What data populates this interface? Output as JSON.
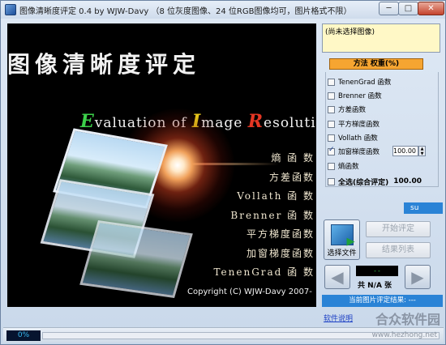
{
  "window": {
    "title": "图像清晰度评定 0.4 by WJW-Davy （8 位灰度图像、24 位RGB图像均可，图片格式不限）",
    "min_symbol": "─",
    "max_symbol": "□",
    "close_symbol": "✕"
  },
  "banner": {
    "title_cn": "图像清晰度评定",
    "en_cap_e": "E",
    "en_rest_e": "valuation of ",
    "en_cap_i": "I",
    "en_rest_i": "mage ",
    "en_cap_r": "R",
    "en_rest_r": "esolutio",
    "methods": [
      "熵 函 数",
      "方差函数",
      "Vollath 函 数",
      "Brenner 函 数",
      "平方梯度函数",
      "加窗梯度函数",
      "TenenGrad 函 数"
    ],
    "copyright": "Copyright (C) WJW-Davy 2007-"
  },
  "file_box": {
    "text": "(尚未选择图像)"
  },
  "method_panel": {
    "header": "方法  权重(%)",
    "methods": [
      {
        "label": "TenenGrad 函数",
        "checked": false
      },
      {
        "label": "Brenner 函数",
        "checked": false
      },
      {
        "label": "方差函数",
        "checked": false
      },
      {
        "label": "平方梯度函数",
        "checked": false
      },
      {
        "label": "Vollath 函数",
        "checked": false
      },
      {
        "label": "加窗梯度函数",
        "checked": true
      },
      {
        "label": "熵函数",
        "checked": false
      }
    ],
    "weight_value": "100.00",
    "select_all_label": "全选(综合评定)",
    "select_all_score": "100.00"
  },
  "score_bar": {
    "text": "su"
  },
  "buttons": {
    "select_file": "选择文件",
    "start_eval": "开始评定",
    "result_list": "结果列表",
    "prev_symbol": "◀",
    "next_symbol": "▶"
  },
  "counter": {
    "display": "--",
    "text": "共 N/A 张"
  },
  "result": {
    "text": "当前图片评定结果: ---"
  },
  "help_link": "软件说明",
  "status": {
    "progress_label": "0%",
    "progress": 0.0
  },
  "watermark": {
    "text": "合众软件园",
    "url": "www.hezhong.net"
  },
  "colors": {
    "accent_blue": "#2a83d6",
    "header_orange": "#f6a531",
    "counter_green": "#38d64a"
  }
}
